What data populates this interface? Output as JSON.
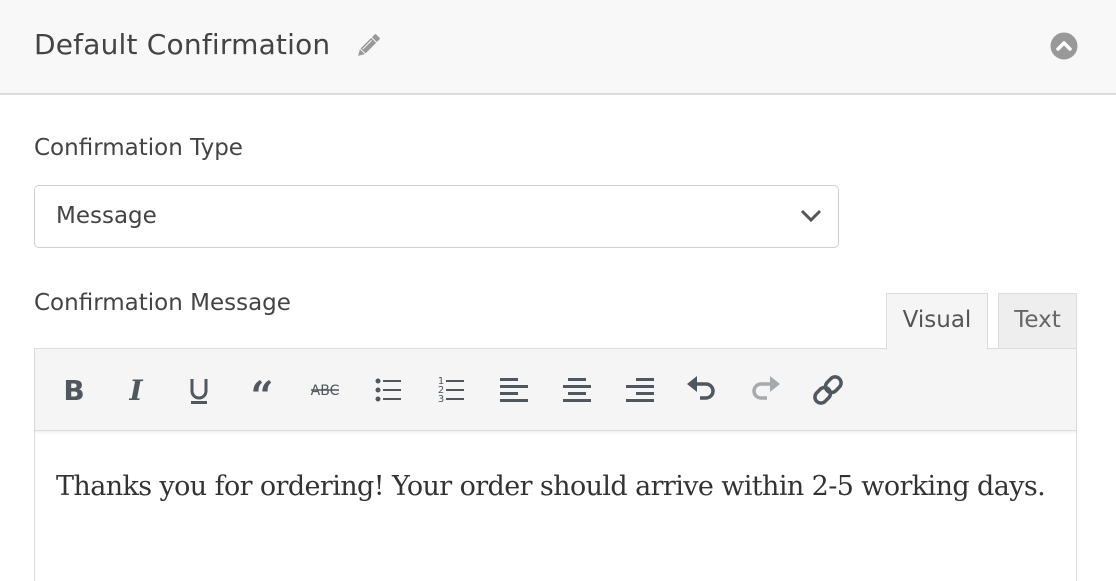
{
  "panel": {
    "title": "Default Confirmation",
    "edit_icon": "pencil-icon",
    "collapse_icon": "chevron-up-circle-icon"
  },
  "confirmation_type": {
    "label": "Confirmation Type",
    "selected": "Message",
    "dropdown_icon": "chevron-down-icon"
  },
  "confirmation_message": {
    "label": "Confirmation Message",
    "tabs": [
      {
        "label": "Visual",
        "active": true
      },
      {
        "label": "Text",
        "active": false
      }
    ],
    "toolbar": [
      {
        "name": "bold",
        "icon": "bold-icon"
      },
      {
        "name": "italic",
        "icon": "italic-icon"
      },
      {
        "name": "underline",
        "icon": "underline-icon"
      },
      {
        "name": "blockquote",
        "icon": "blockquote-icon"
      },
      {
        "name": "strikethrough",
        "icon": "strikethrough-icon"
      },
      {
        "name": "bullet-list",
        "icon": "bullet-list-icon"
      },
      {
        "name": "numbered-list",
        "icon": "numbered-list-icon"
      },
      {
        "name": "align-left",
        "icon": "align-left-icon"
      },
      {
        "name": "align-center",
        "icon": "align-center-icon"
      },
      {
        "name": "align-right",
        "icon": "align-right-icon"
      },
      {
        "name": "undo",
        "icon": "undo-icon"
      },
      {
        "name": "redo",
        "icon": "redo-icon",
        "disabled": true
      },
      {
        "name": "link",
        "icon": "link-icon"
      }
    ],
    "content": "Thanks you for ordering! Your order should arrive within 2-5 working days."
  },
  "colors": {
    "header_bg": "#f8f8f8",
    "text": "#444444",
    "icon": "#50575e",
    "icon_disabled": "#a7aaad",
    "muted_icon": "#999999"
  }
}
